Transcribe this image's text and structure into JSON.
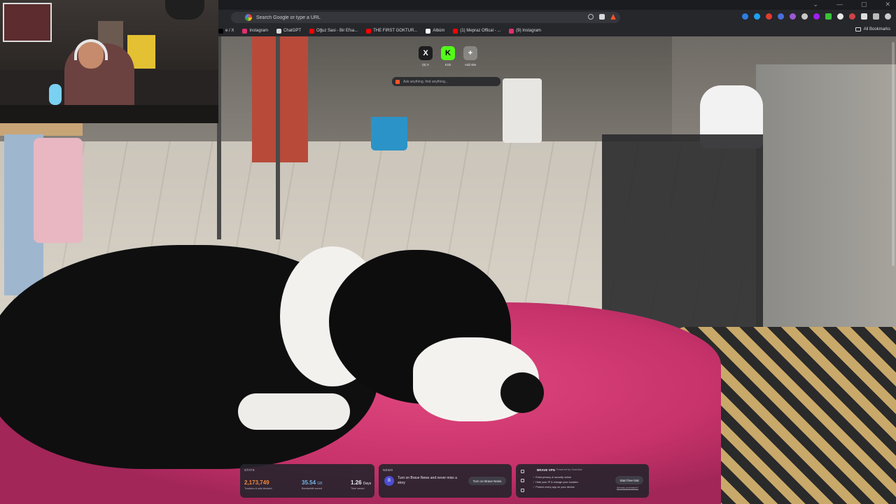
{
  "omnibox": {
    "placeholder": "Search Google or type a URL"
  },
  "bookmarks": {
    "items": [
      {
        "label": "e / X",
        "icon": "x-icon",
        "color": "#000000"
      },
      {
        "label": "Instagram",
        "icon": "instagram-icon",
        "color": "#e1306c"
      },
      {
        "label": "ChatGPT",
        "icon": "chatgpt-icon",
        "color": "#d9d9d9"
      },
      {
        "label": "Oğuz Sasi - Bir Efsa...",
        "icon": "youtube-icon",
        "color": "#ff0000"
      },
      {
        "label": "THE FIRST GOKTUR...",
        "icon": "youtube-icon",
        "color": "#ff0000"
      },
      {
        "label": "Albüm",
        "icon": "album-icon",
        "color": "#ffffff"
      },
      {
        "label": "(1) Mepraz Offical - ...",
        "icon": "youtube-icon",
        "color": "#ff0000"
      },
      {
        "label": "(9) Instagram",
        "icon": "instagram-icon",
        "color": "#e1306c"
      }
    ],
    "all_label": "All Bookmarks"
  },
  "tiles": [
    {
      "label": "(6) X",
      "glyph": "X",
      "bg": "#1d1d1f",
      "fg": "#ffffff"
    },
    {
      "label": "Kick",
      "glyph": "K",
      "bg": "#53fc18",
      "fg": "#000000"
    },
    {
      "label": "Add site",
      "glyph": "+",
      "bg": "rgba(255,255,255,0.25)",
      "fg": "#ffffff"
    }
  ],
  "ask": {
    "placeholder": "Ask anything, find anything..."
  },
  "stats": {
    "title": "STATS",
    "trackers_value": "2,173,749",
    "trackers_label": "Trackers & ads blocked",
    "bandwidth_value": "35.54",
    "bandwidth_unit": "GB",
    "bandwidth_label": "Bandwidth saved",
    "time_value": "1.26",
    "time_unit": "Days",
    "time_label": "Time saved",
    "trackers_color": "#f08a3e",
    "bandwidth_color": "#6fb8e8"
  },
  "news": {
    "title": "NEWS",
    "logo": "B",
    "text": "Turn on Brave News and never miss a story",
    "button": "Turn on Brave News"
  },
  "vpn": {
    "title": "BRAVE VPN",
    "powered": "Powered by Guardian",
    "features": [
      "Extra privacy & security online",
      "Hide your IP & change your location",
      "Protect every app on your device"
    ],
    "button": "Start free trial",
    "already": "Already purchased?"
  }
}
